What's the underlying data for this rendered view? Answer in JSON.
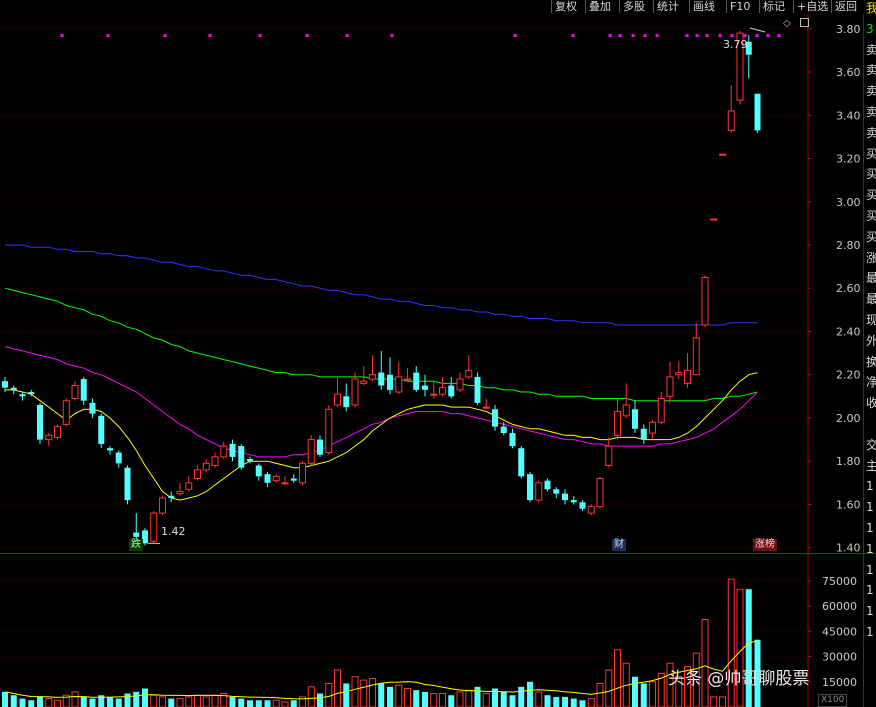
{
  "toolbar": {
    "buttons": [
      "复权",
      "叠加",
      "多股",
      "统计",
      "画线",
      "F10",
      "标记",
      "+自选",
      "返回"
    ]
  },
  "side_panel": {
    "chars": [
      "我",
      "3",
      "卖",
      "卖",
      "卖",
      "卖",
      "卖",
      "买",
      "买",
      "买",
      "买",
      "买",
      "涨",
      "最",
      "最",
      "现",
      "外",
      "换",
      "净",
      "收",
      "",
      "交",
      "主",
      "1",
      "1",
      "1",
      "1",
      "1",
      "1",
      "1",
      "1"
    ]
  },
  "colors": {
    "up": "#ff3232",
    "down": "#54ffff",
    "ma5": "#ffff00",
    "ma10": "#ff00ff",
    "ma20": "#00ff00",
    "ma60": "#3333ff",
    "axis": "#aa0000",
    "dots": "#ff00ff"
  },
  "tags": {
    "die": "跌",
    "cai": "财",
    "zhangbang": "涨榜"
  },
  "annotations": {
    "high_label": "3.79",
    "low_label": "1.42"
  },
  "watermark": "头条 @帅哥聊股票",
  "volume_unit": "X100",
  "chart_data": [
    {
      "type": "candlestick",
      "price_axis_ticks": [
        3.8,
        3.6,
        3.4,
        3.2,
        3.0,
        2.8,
        2.6,
        2.4,
        2.2,
        2.0,
        1.8,
        1.6,
        1.4
      ],
      "price_axis_labels": [
        "3.80",
        "3.60",
        "3.40",
        "3.20",
        "3.00",
        "2.80",
        "2.60",
        "2.40",
        "2.20",
        "2.00",
        "1.80",
        "1.60",
        "1.40"
      ],
      "ylim": [
        1.38,
        3.85
      ],
      "grid": true,
      "candles": [
        [
          2.17,
          2.14,
          2.19,
          2.12
        ],
        [
          2.14,
          2.13,
          2.15,
          2.11
        ],
        [
          2.11,
          2.1,
          2.12,
          2.08
        ],
        [
          2.12,
          2.11,
          2.13,
          2.1
        ],
        [
          2.06,
          1.9,
          2.07,
          1.88
        ],
        [
          1.9,
          1.92,
          1.93,
          1.87
        ],
        [
          1.91,
          1.96,
          1.97,
          1.9
        ],
        [
          1.97,
          2.08,
          2.09,
          1.96
        ],
        [
          2.09,
          2.15,
          2.17,
          2.08
        ],
        [
          2.18,
          2.08,
          2.19,
          2.06
        ],
        [
          2.07,
          2.02,
          2.09,
          2.0
        ],
        [
          2.01,
          1.88,
          2.02,
          1.86
        ],
        [
          1.86,
          1.85,
          1.87,
          1.83
        ],
        [
          1.84,
          1.79,
          1.85,
          1.77
        ],
        [
          1.77,
          1.62,
          1.78,
          1.6
        ],
        [
          1.47,
          1.45,
          1.56,
          1.42
        ],
        [
          1.48,
          1.42,
          1.49,
          1.41
        ],
        [
          1.43,
          1.56,
          1.57,
          1.42
        ],
        [
          1.56,
          1.63,
          1.64,
          1.55
        ],
        [
          1.64,
          1.63,
          1.66,
          1.61
        ],
        [
          1.65,
          1.66,
          1.7,
          1.64
        ],
        [
          1.67,
          1.7,
          1.73,
          1.66
        ],
        [
          1.72,
          1.76,
          1.78,
          1.71
        ],
        [
          1.76,
          1.79,
          1.81,
          1.75
        ],
        [
          1.78,
          1.82,
          1.84,
          1.77
        ],
        [
          1.82,
          1.87,
          1.89,
          1.81
        ],
        [
          1.88,
          1.82,
          1.9,
          1.8
        ],
        [
          1.87,
          1.77,
          1.88,
          1.76
        ],
        [
          1.81,
          1.8,
          1.82,
          1.79
        ],
        [
          1.78,
          1.73,
          1.79,
          1.71
        ],
        [
          1.74,
          1.7,
          1.75,
          1.68
        ],
        [
          1.71,
          1.73,
          1.74,
          1.7
        ],
        [
          1.7,
          1.7,
          1.73,
          1.69
        ],
        [
          1.72,
          1.71,
          1.74,
          1.7
        ],
        [
          1.7,
          1.79,
          1.8,
          1.69
        ],
        [
          1.79,
          1.9,
          1.92,
          1.78
        ],
        [
          1.9,
          1.83,
          1.92,
          1.82
        ],
        [
          1.84,
          2.04,
          2.06,
          1.83
        ],
        [
          2.06,
          2.11,
          2.19,
          2.05
        ],
        [
          2.1,
          2.05,
          2.16,
          2.03
        ],
        [
          2.06,
          2.18,
          2.21,
          2.05
        ],
        [
          2.16,
          2.17,
          2.24,
          2.15
        ],
        [
          2.18,
          2.2,
          2.29,
          2.17
        ],
        [
          2.21,
          2.15,
          2.31,
          2.13
        ],
        [
          2.2,
          2.13,
          2.28,
          2.11
        ],
        [
          2.12,
          2.19,
          2.26,
          2.11
        ],
        [
          2.18,
          2.18,
          2.23,
          2.17
        ],
        [
          2.21,
          2.13,
          2.24,
          2.12
        ],
        [
          2.15,
          2.13,
          2.2,
          2.1
        ],
        [
          2.11,
          2.11,
          2.17,
          2.09
        ],
        [
          2.11,
          2.14,
          2.19,
          2.1
        ],
        [
          2.15,
          2.1,
          2.19,
          2.09
        ],
        [
          2.13,
          2.18,
          2.21,
          2.12
        ],
        [
          2.19,
          2.22,
          2.29,
          2.18
        ],
        [
          2.19,
          2.07,
          2.21,
          2.06
        ],
        [
          2.05,
          2.05,
          2.09,
          2.04
        ],
        [
          2.04,
          1.96,
          2.06,
          1.94
        ],
        [
          1.96,
          1.93,
          1.98,
          1.92
        ],
        [
          1.93,
          1.87,
          1.95,
          1.86
        ],
        [
          1.86,
          1.73,
          1.87,
          1.72
        ],
        [
          1.74,
          1.62,
          1.75,
          1.61
        ],
        [
          1.62,
          1.7,
          1.71,
          1.61
        ],
        [
          1.71,
          1.67,
          1.72,
          1.66
        ],
        [
          1.67,
          1.65,
          1.68,
          1.63
        ],
        [
          1.65,
          1.62,
          1.67,
          1.6
        ],
        [
          1.62,
          1.61,
          1.64,
          1.6
        ],
        [
          1.61,
          1.58,
          1.62,
          1.57
        ],
        [
          1.56,
          1.59,
          1.6,
          1.55
        ],
        [
          1.59,
          1.72,
          1.73,
          1.58
        ],
        [
          1.78,
          1.87,
          1.91,
          1.77
        ],
        [
          1.92,
          2.03,
          2.09,
          1.9
        ],
        [
          2.01,
          2.06,
          2.16,
          2.0
        ],
        [
          2.04,
          1.95,
          2.08,
          1.93
        ],
        [
          1.95,
          1.9,
          1.97,
          1.88
        ],
        [
          1.93,
          1.98,
          1.99,
          1.9
        ],
        [
          1.98,
          2.09,
          2.12,
          1.97
        ],
        [
          2.1,
          2.19,
          2.26,
          2.07
        ],
        [
          2.2,
          2.21,
          2.26,
          2.18
        ],
        [
          2.16,
          2.22,
          2.3,
          2.14
        ],
        [
          2.2,
          2.37,
          2.44,
          2.2
        ],
        [
          2.43,
          2.65,
          2.66,
          2.42
        ],
        [
          2.92,
          2.92,
          2.92,
          2.92
        ],
        [
          3.22,
          3.22,
          3.22,
          3.22
        ],
        [
          3.33,
          3.42,
          3.54,
          3.32
        ],
        [
          3.47,
          3.78,
          3.79,
          3.45
        ],
        [
          3.74,
          3.68,
          3.77,
          3.57
        ],
        [
          3.5,
          3.33,
          3.5,
          3.32
        ]
      ],
      "ma5": [
        2.13,
        2.13,
        2.12,
        2.11,
        2.08,
        2.05,
        2.02,
        1.99,
        2.02,
        2.04,
        2.04,
        2.03,
        2.0,
        1.96,
        1.91,
        1.85,
        1.78,
        1.72,
        1.66,
        1.63,
        1.62,
        1.63,
        1.64,
        1.66,
        1.69,
        1.72,
        1.75,
        1.78,
        1.8,
        1.8,
        1.8,
        1.79,
        1.78,
        1.77,
        1.77,
        1.78,
        1.79,
        1.8,
        1.82,
        1.84,
        1.87,
        1.9,
        1.94,
        1.97,
        2.0,
        2.02,
        2.04,
        2.05,
        2.06,
        2.06,
        2.06,
        2.05,
        2.05,
        2.05,
        2.04,
        2.03,
        2.01,
        1.99,
        1.97,
        1.96,
        1.95,
        1.95,
        1.94,
        1.93,
        1.92,
        1.92,
        1.91,
        1.91,
        1.9,
        1.9,
        1.91,
        1.91,
        1.91,
        1.9,
        1.9,
        1.9,
        1.9,
        1.91,
        1.93,
        1.96,
        2.0,
        2.04,
        2.08,
        2.13,
        2.17,
        2.2,
        2.21
      ],
      "ma10": [
        2.33,
        2.32,
        2.31,
        2.3,
        2.29,
        2.28,
        2.27,
        2.25,
        2.24,
        2.23,
        2.21,
        2.2,
        2.18,
        2.16,
        2.14,
        2.12,
        2.09,
        2.06,
        2.03,
        2.0,
        1.97,
        1.95,
        1.92,
        1.9,
        1.88,
        1.86,
        1.85,
        1.84,
        1.83,
        1.82,
        1.82,
        1.82,
        1.82,
        1.83,
        1.83,
        1.84,
        1.85,
        1.87,
        1.89,
        1.91,
        1.93,
        1.95,
        1.97,
        1.98,
        2.0,
        2.01,
        2.02,
        2.03,
        2.03,
        2.03,
        2.03,
        2.02,
        2.02,
        2.01,
        2.0,
        1.99,
        1.98,
        1.97,
        1.96,
        1.95,
        1.94,
        1.93,
        1.92,
        1.91,
        1.9,
        1.9,
        1.89,
        1.88,
        1.88,
        1.87,
        1.87,
        1.87,
        1.87,
        1.87,
        1.87,
        1.88,
        1.88,
        1.89,
        1.9,
        1.91,
        1.93,
        1.95,
        1.98,
        2.01,
        2.04,
        2.08,
        2.12
      ],
      "ma20": [
        2.6,
        2.59,
        2.58,
        2.57,
        2.56,
        2.55,
        2.54,
        2.52,
        2.51,
        2.5,
        2.48,
        2.47,
        2.45,
        2.44,
        2.42,
        2.41,
        2.39,
        2.37,
        2.36,
        2.34,
        2.33,
        2.31,
        2.3,
        2.29,
        2.28,
        2.27,
        2.26,
        2.25,
        2.24,
        2.23,
        2.22,
        2.21,
        2.21,
        2.2,
        2.2,
        2.2,
        2.19,
        2.19,
        2.19,
        2.19,
        2.19,
        2.19,
        2.18,
        2.18,
        2.18,
        2.18,
        2.17,
        2.17,
        2.17,
        2.17,
        2.16,
        2.16,
        2.16,
        2.15,
        2.15,
        2.14,
        2.14,
        2.13,
        2.13,
        2.12,
        2.12,
        2.11,
        2.11,
        2.1,
        2.1,
        2.1,
        2.1,
        2.09,
        2.09,
        2.09,
        2.09,
        2.09,
        2.08,
        2.08,
        2.08,
        2.08,
        2.08,
        2.08,
        2.08,
        2.08,
        2.08,
        2.09,
        2.09,
        2.1,
        2.1,
        2.11,
        2.12
      ],
      "ma60": [
        2.8,
        2.8,
        2.8,
        2.79,
        2.79,
        2.79,
        2.78,
        2.78,
        2.77,
        2.77,
        2.77,
        2.76,
        2.76,
        2.75,
        2.75,
        2.74,
        2.74,
        2.73,
        2.72,
        2.72,
        2.71,
        2.7,
        2.7,
        2.69,
        2.68,
        2.68,
        2.67,
        2.66,
        2.66,
        2.65,
        2.64,
        2.64,
        2.63,
        2.62,
        2.61,
        2.61,
        2.6,
        2.59,
        2.59,
        2.58,
        2.57,
        2.57,
        2.56,
        2.55,
        2.55,
        2.54,
        2.54,
        2.53,
        2.52,
        2.52,
        2.51,
        2.51,
        2.5,
        2.5,
        2.49,
        2.49,
        2.48,
        2.48,
        2.47,
        2.47,
        2.46,
        2.46,
        2.46,
        2.45,
        2.45,
        2.45,
        2.44,
        2.44,
        2.44,
        2.44,
        2.43,
        2.43,
        2.43,
        2.43,
        2.43,
        2.43,
        2.43,
        2.43,
        2.43,
        2.43,
        2.43,
        2.43,
        2.43,
        2.44,
        2.44,
        2.44,
        2.44
      ]
    },
    {
      "type": "bar",
      "volume_axis_labels": [
        "75000",
        "60000",
        "45000",
        "30000",
        "15000"
      ],
      "volume_axis_values": [
        75000,
        60000,
        45000,
        30000,
        15000
      ],
      "ylim": [
        0,
        85000
      ],
      "volumes": [
        9000,
        7000,
        5000,
        4000,
        6000,
        5000,
        4000,
        7000,
        9000,
        6000,
        5000,
        7000,
        6000,
        5000,
        8000,
        9000,
        11000,
        7000,
        6000,
        5000,
        5000,
        6000,
        7000,
        6000,
        7000,
        8000,
        6000,
        5000,
        4000,
        4000,
        4000,
        4000,
        3000,
        4000,
        6000,
        12000,
        8000,
        14000,
        22000,
        14000,
        18000,
        16000,
        17000,
        14000,
        12000,
        13000,
        11000,
        10000,
        9000,
        8000,
        8000,
        7000,
        9000,
        10000,
        12000,
        8000,
        11000,
        9000,
        7000,
        12000,
        15000,
        9000,
        7000,
        6000,
        6000,
        5000,
        4000,
        5000,
        14000,
        22000,
        34000,
        26000,
        18000,
        14000,
        15000,
        20000,
        26000,
        18000,
        24000,
        32000,
        52000,
        6000,
        6000,
        76000,
        70000,
        70000,
        40000
      ]
    }
  ]
}
